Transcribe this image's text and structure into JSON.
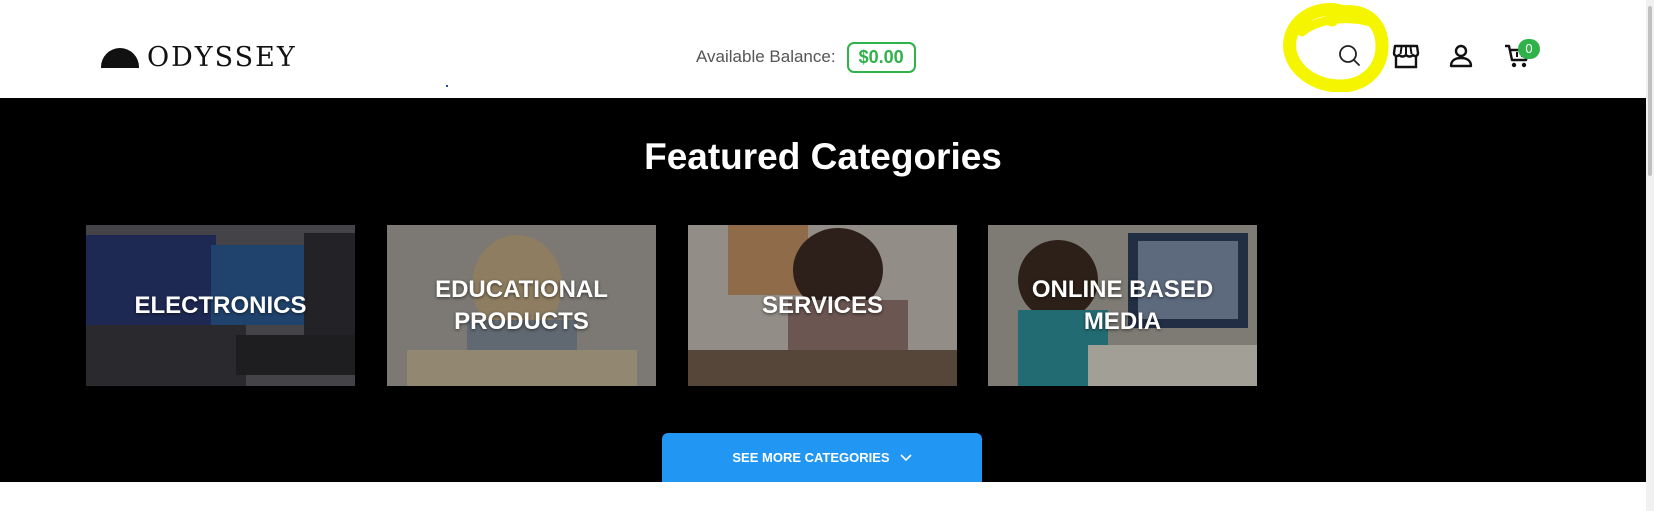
{
  "header": {
    "logo_text": "ODYSSEY",
    "balance_label": "Available Balance:",
    "balance_value": "$0.00",
    "icons": [
      "search-icon",
      "store-icon",
      "user-icon",
      "cart-icon"
    ],
    "cart_count": "0"
  },
  "featured": {
    "title": "Featured Categories",
    "categories": [
      {
        "label_lines": [
          "ELECTRONICS"
        ]
      },
      {
        "label_lines": [
          "EDUCATIONAL",
          "PRODUCTS"
        ]
      },
      {
        "label_lines": [
          "SERVICES"
        ]
      },
      {
        "label_lines": [
          "ONLINE BASED",
          "MEDIA"
        ]
      }
    ],
    "see_more_label": "SEE MORE CATEGORIES"
  },
  "colors": {
    "balance_green": "#2fb24a",
    "button_blue": "#2196f3",
    "section_bg": "#000000",
    "highlight_yellow": "#f5f500"
  }
}
